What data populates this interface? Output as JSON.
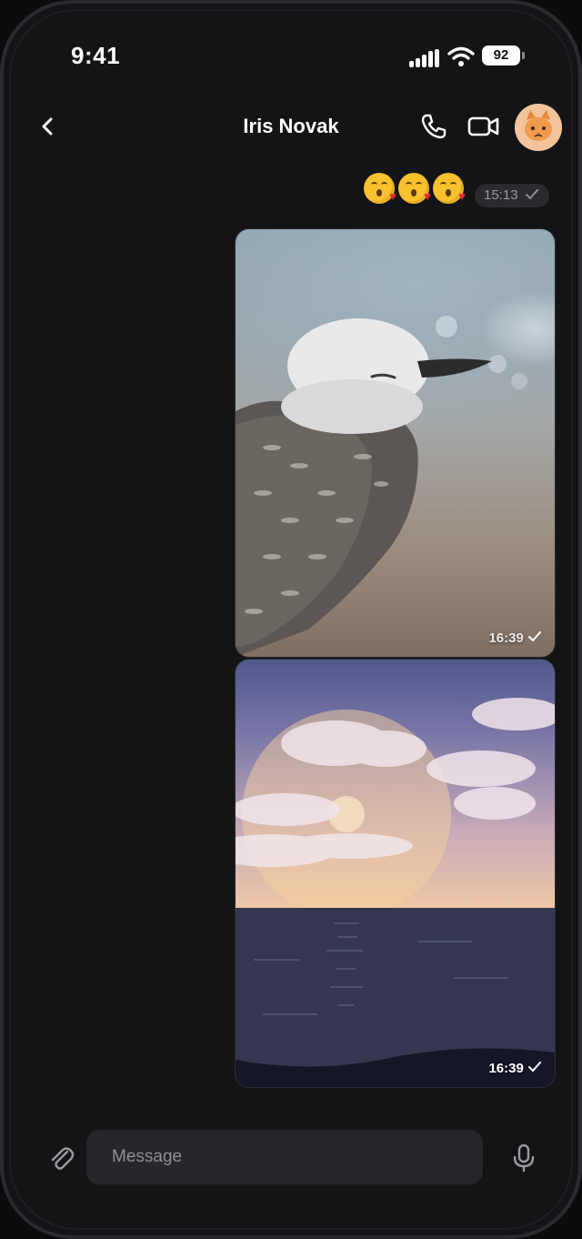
{
  "status": {
    "time": "9:41",
    "battery": "92"
  },
  "header": {
    "title": "Iris Novak"
  },
  "messages": [
    {
      "type": "emoji",
      "content": "😘😘😘",
      "time": "15:13"
    },
    {
      "type": "photo",
      "subject": "bird",
      "time": "16:39"
    },
    {
      "type": "photo",
      "subject": "sunset",
      "time": "16:39"
    }
  ],
  "composer": {
    "placeholder": "Message"
  },
  "colors": {
    "background": "#141416",
    "bubble": "#2a2b2e",
    "input": "#26272b"
  },
  "icons": [
    "back-chevron-icon",
    "phone-icon",
    "video-camera-icon",
    "paperclip-icon",
    "microphone-icon",
    "checkmark-icon"
  ]
}
